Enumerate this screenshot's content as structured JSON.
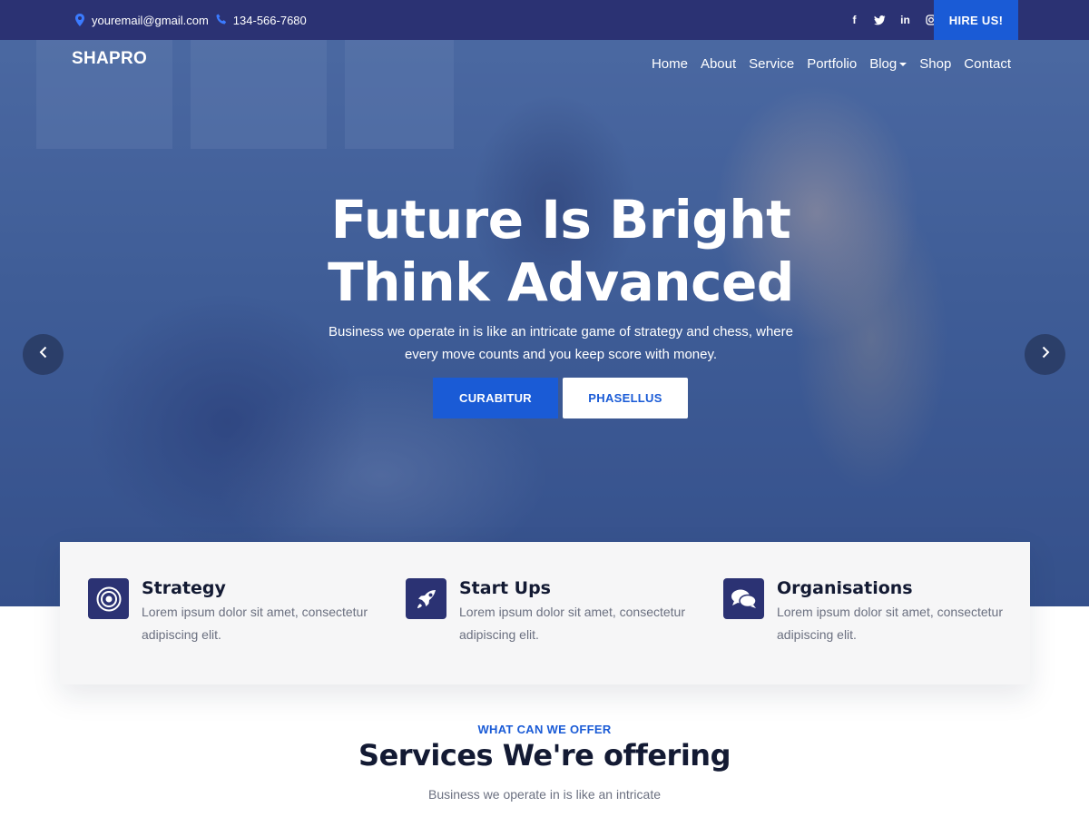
{
  "topbar": {
    "email": "youremail@gmail.com",
    "phone": "134-566-7680",
    "social": [
      {
        "icon": "facebook-icon",
        "glyph": "f"
      },
      {
        "icon": "twitter-icon",
        "glyph": "t"
      },
      {
        "icon": "linkedin-icon",
        "glyph": "in"
      },
      {
        "icon": "instagram-icon",
        "glyph": "◎"
      }
    ],
    "hire_label": "HIRE US!"
  },
  "header": {
    "logo": "SHAPRO",
    "nav": [
      "Home",
      "About",
      "Service",
      "Portfolio",
      "Blog",
      "Shop",
      "Contact"
    ]
  },
  "hero": {
    "title_line1": "Future Is Bright",
    "title_line2": "Think Advanced",
    "text": "Business we operate in is like an intricate game of strategy and chess, where every move counts and you keep score with money.",
    "primary_button": "CURABITUR",
    "secondary_button": "PHASELLUS"
  },
  "features": [
    {
      "title": "Strategy",
      "desc": "Lorem ipsum dolor sit amet, consectetur adipiscing elit.",
      "icon": "target-icon"
    },
    {
      "title": "Start Ups",
      "desc": "Lorem ipsum dolor sit amet, consectetur adipiscing elit.",
      "icon": "rocket-icon"
    },
    {
      "title": "Organisations",
      "desc": "Lorem ipsum dolor sit amet, consectetur adipiscing elit.",
      "icon": "chat-bubbles-icon"
    }
  ],
  "services": {
    "eyebrow": "WHAT CAN WE OFFER",
    "title": "Services We're offering",
    "subtitle": "Business we operate in is like an intricate"
  },
  "colors": {
    "topbar_bg": "#2b3273",
    "accent": "#1a5bd6",
    "icon_box": "#2b3273",
    "heading": "#131a33"
  }
}
